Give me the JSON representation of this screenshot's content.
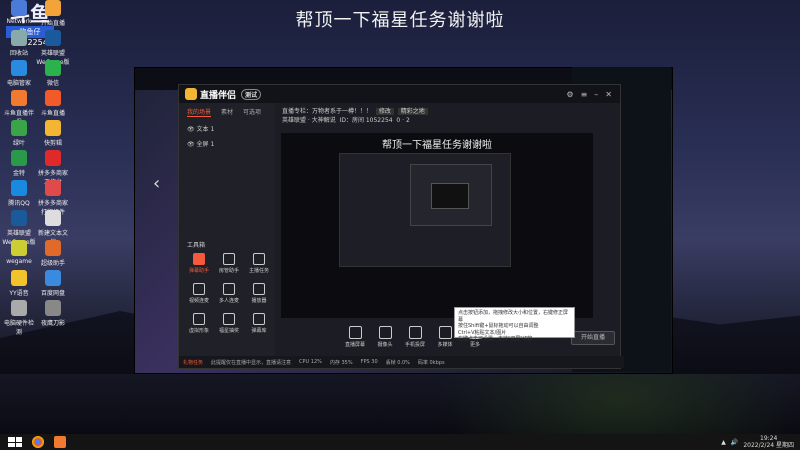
{
  "headline": "帮顶一下福星任务谢谢啦",
  "badge": {
    "name": "斗鱼",
    "user": "鲍鱼仔",
    "id": "1052254"
  },
  "desktop_icons": [
    {
      "label": "Network",
      "color": "#4a7bd8"
    },
    {
      "label": "开始直播",
      "color": "#f2a33a"
    },
    {
      "label": "回收站",
      "color": "#8aa"
    },
    {
      "label": "英雄联盟 WeGame版",
      "color": "#1a5a9a"
    },
    {
      "label": "电脑管家",
      "color": "#2a8ae0"
    },
    {
      "label": "微信",
      "color": "#2bb24c"
    },
    {
      "label": "斗鱼直播伴侣",
      "color": "#f27a30"
    },
    {
      "label": "斗鱼直播",
      "color": "#f25a2a"
    },
    {
      "label": "绿叶",
      "color": "#3aa548"
    },
    {
      "label": "快剪辑",
      "color": "#f2b632"
    },
    {
      "label": "金特",
      "color": "#2a9a4a"
    },
    {
      "label": "拼多多商家工作台",
      "color": "#e02a2a"
    },
    {
      "label": "腾讯QQ",
      "color": "#1a8ae0"
    },
    {
      "label": "拼多多商家打印组件",
      "color": "#e04a4a"
    },
    {
      "label": "英雄联盟 WeGame版",
      "color": "#1a5a9a"
    },
    {
      "label": "新建文本文档",
      "color": "#ddd"
    },
    {
      "label": "wegame",
      "color": "#cc3"
    },
    {
      "label": "超级助手",
      "color": "#e06a2a"
    },
    {
      "label": "YY语音",
      "color": "#f2c32a"
    },
    {
      "label": "百度网盘",
      "color": "#3a8ae0"
    },
    {
      "label": "电脑硬件检测",
      "color": "#aaa"
    },
    {
      "label": "夜鹰刀影",
      "color": "#888"
    }
  ],
  "app": {
    "brand": "直播伴侣",
    "version": "测试",
    "tabs": [
      "我的场景",
      "素材",
      "可选项"
    ],
    "scenes": [
      "文本 1",
      "全屏 1"
    ],
    "tools_title": "工具箱",
    "tools": [
      {
        "label": "弹幕助手",
        "hot": true
      },
      {
        "label": "房管助手",
        "hot": false
      },
      {
        "label": "主播任务",
        "hot": false
      },
      {
        "label": "视频连麦",
        "hot": false
      },
      {
        "label": "多人连麦",
        "hot": false
      },
      {
        "label": "播放器",
        "hot": false
      },
      {
        "label": "虚拟形象",
        "hot": false
      },
      {
        "label": "福星抽奖",
        "hot": false
      },
      {
        "label": "弹幕库",
        "hot": false
      }
    ],
    "info_title": "直播专栏：万物者系于一樽！！！",
    "info_tag1": "修改",
    "info_tag2": "精彩之地",
    "info_category": "英雄联盟 · 大神解说",
    "info_room": "ID：房间 1052254",
    "info_stats": "0 · 2",
    "preview_title": "帮顶一下福星任务谢谢啦",
    "bottom_tools": [
      "直播屏幕",
      "摄像头",
      "手机投屏",
      "多媒体",
      "更多"
    ],
    "start_label": "开始直播",
    "status": [
      "礼物任务",
      "此提醒仅在直播中显示，直播请注意",
      "CPU 12%",
      "内存 35%",
      "FPS 30",
      "丢帧 0.0%",
      "码率 0kbps"
    ],
    "tooltip": [
      "点击按钮添加，拖拽修改大小和位置，右键修正屏幕",
      "按住Shift键+鼠标拖动可以自由调整",
      "Ctrl+V粘贴文本/图片",
      "右键点击可设置，支持\"双屏\"切换"
    ]
  },
  "taskbar": {
    "time": "19:24",
    "date": "2022/2/24 星期四"
  }
}
